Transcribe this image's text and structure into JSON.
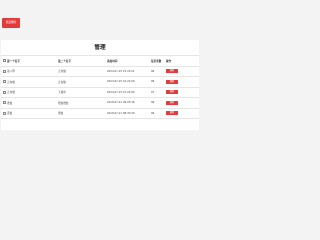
{
  "toolbar": {
    "batch_delete_label": "批量删除"
  },
  "panel": {
    "title": "管理"
  },
  "table": {
    "headers": [
      "",
      "第一个名字",
      "第二个名字",
      "添加时间",
      "每页条数",
      "操作"
    ],
    "rows": [
      {
        "first": "第八甲",
        "second": "正在做",
        "time": "2024-07-15 15:22:01",
        "count": "96",
        "action": "删除"
      },
      {
        "first": "正在做",
        "second": "正在做",
        "time": "2024-07-15 15:22:00",
        "count": "96",
        "action": "删除"
      },
      {
        "first": "正在做",
        "second": "下载中",
        "time": "2024-07-15 15:22:00",
        "count": "97",
        "action": "删除"
      },
      {
        "first": "增加",
        "second": "增加增加",
        "time": "2019-07-21 09:05:36",
        "count": "96",
        "action": "删除"
      },
      {
        "first": "添加",
        "second": "增加",
        "time": "2019-07-21 08:33:29",
        "count": "96",
        "action": "删除"
      }
    ]
  }
}
